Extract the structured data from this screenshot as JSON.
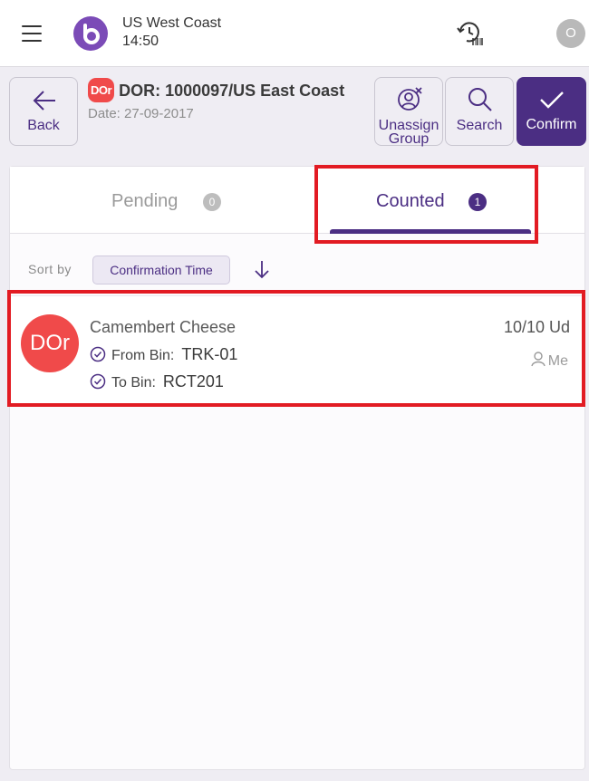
{
  "topbar": {
    "store_name": "US West Coast",
    "time": "14:50",
    "user_initial": "O",
    "menu_icon": "hamburger-menu-icon",
    "logo_icon": "app-logo-icon",
    "history_icon": "history-barcode-icon"
  },
  "header": {
    "back_label": "Back",
    "doc_badge": "DOr",
    "doc_title": "DOR: 1000097/US East Coast",
    "doc_date": "Date: 27-09-2017",
    "unassign_label_1": "Unassign",
    "unassign_label_2": "Group",
    "search_label": "Search",
    "confirm_label": "Confirm"
  },
  "tabs": [
    {
      "label": "Pending",
      "count": "0",
      "active": false
    },
    {
      "label": "Counted",
      "count": "1",
      "active": true
    }
  ],
  "sort": {
    "label": "Sort by",
    "field": "Confirmation Time",
    "direction_icon": "arrow-down-icon"
  },
  "items": [
    {
      "avatar": "DOr",
      "name": "Camembert Cheese",
      "from_label": "From Bin:",
      "from_value": "TRK-01",
      "to_label": "To Bin:",
      "to_value": "RCT201",
      "quantity": "10/10 Ud",
      "assignee": "Me"
    }
  ],
  "colors": {
    "brand": "#4b2e83",
    "badge_red": "#f04a4a",
    "highlight_red": "#e21b23"
  }
}
